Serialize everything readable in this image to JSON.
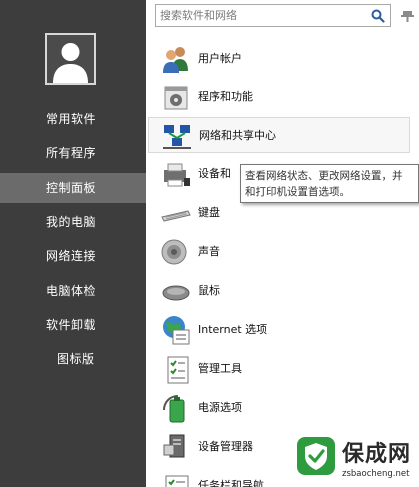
{
  "search": {
    "placeholder": "搜索软件和网络"
  },
  "sidebar": {
    "items": [
      {
        "label": "常用软件"
      },
      {
        "label": "所有程序"
      },
      {
        "label": "控制面板",
        "active": true
      },
      {
        "label": "我的电脑"
      },
      {
        "label": "网络连接"
      },
      {
        "label": "电脑体检"
      },
      {
        "label": "软件卸载"
      },
      {
        "label": "图标版"
      }
    ]
  },
  "control_panel": {
    "items": [
      {
        "label": "用户帐户",
        "icon": "users-icon"
      },
      {
        "label": "程序和功能",
        "icon": "programs-icon"
      },
      {
        "label": "网络和共享中心",
        "icon": "network-icon"
      },
      {
        "label": "设备和",
        "icon": "printer-icon"
      },
      {
        "label": "键盘",
        "icon": "keyboard-icon"
      },
      {
        "label": "声音",
        "icon": "speaker-icon"
      },
      {
        "label": "鼠标",
        "icon": "mouse-icon"
      },
      {
        "label": "Internet 选项",
        "icon": "internet-icon"
      },
      {
        "label": "管理工具",
        "icon": "admin-tools-icon"
      },
      {
        "label": "电源选项",
        "icon": "power-icon"
      },
      {
        "label": "设备管理器",
        "icon": "device-manager-icon"
      },
      {
        "label": "任务栏和导航",
        "icon": "taskbar-icon"
      }
    ]
  },
  "tooltip": {
    "line1": "查看网络状态、更改网络设置，并",
    "line2": "和打印机设置首选项。"
  },
  "watermark": {
    "title": "保成网",
    "url": "zsbaocheng.net"
  },
  "colors": {
    "sidebar_bg": "#3d3d3d",
    "sidebar_active": "#6b6b6b",
    "watermark_green": "#2e9b3e"
  }
}
